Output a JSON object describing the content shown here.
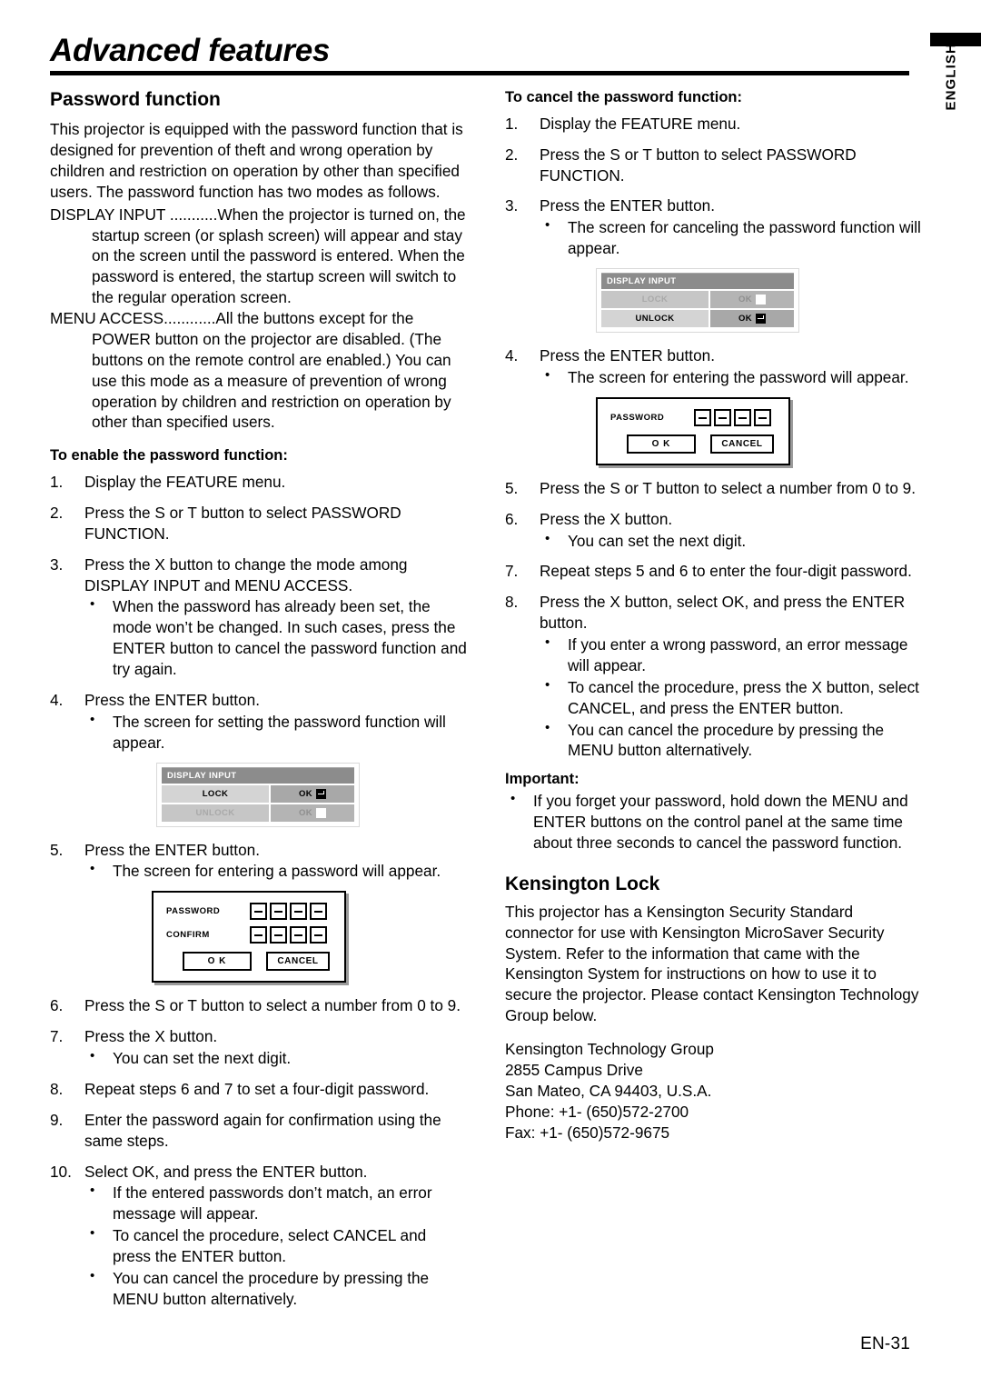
{
  "page": {
    "title": "Advanced features",
    "language_tab": "ENGLISH",
    "folio": "EN-31"
  },
  "left_column": {
    "section_title": "Password function",
    "intro": "This projector is equipped with the password function that is designed for prevention of theft and wrong operation by children and restriction on operation by other than specified users. The password function has two modes as follows.",
    "modes": [
      {
        "name": "DISPLAY INPUT ...........",
        "description": "When the projector is turned on, the startup screen (or splash screen) will appear and stay on the screen until the password is entered. When the password is entered, the startup screen will switch to the regular operation screen."
      },
      {
        "name": "MENU ACCESS............",
        "description": "All the buttons except for the POWER button on the projector are disabled. (The buttons on the remote control are enabled.) You can use this mode as a measure of prevention of wrong operation by children and restriction on operation by other than specified users."
      }
    ],
    "enable_heading": "To enable the password function:",
    "enable_steps": [
      {
        "num": "1.",
        "text": "Display the FEATURE menu."
      },
      {
        "num": "2.",
        "text": "Press the  S or  T button to select PASSWORD FUNCTION."
      },
      {
        "num": "3.",
        "text": "Press the  X button to change the mode among DISPLAY INPUT and MENU ACCESS.",
        "bullets": [
          "When the password has already been set, the mode won’t be changed. In such cases, press the ENTER button to cancel the password function and try again."
        ]
      },
      {
        "num": "4.",
        "text": "Press the ENTER button.",
        "bullets": [
          "The screen for setting the password function will appear."
        ]
      },
      {
        "num": "5.",
        "text": "Press the ENTER button.",
        "bullets": [
          "The screen for entering a password will appear."
        ]
      },
      {
        "num": "6.",
        "text": "Press the  S or  T button to select a number from 0 to 9."
      },
      {
        "num": "7.",
        "text": "Press the  X button.",
        "bullets": [
          "You can set the next digit."
        ]
      },
      {
        "num": "8.",
        "text": "Repeat steps 6 and 7 to set a four-digit password."
      },
      {
        "num": "9.",
        "text": "Enter the password again for confirmation using the same steps."
      },
      {
        "num": "10.",
        "text": "Select OK, and press the ENTER button.",
        "bullets": [
          "If the entered passwords don’t match, an error message will appear.",
          "To cancel the procedure, select CANCEL and press the ENTER button.",
          "You can cancel the procedure by pressing the MENU button alternatively."
        ]
      }
    ],
    "osd_figure": {
      "header": "DISPLAY INPUT",
      "rows": [
        {
          "name": "LOCK",
          "value": "OK",
          "glyph": "enter-key-icon",
          "disabled": false
        },
        {
          "name": "UNLOCK",
          "value": "OK",
          "glyph": "blank-square-icon",
          "disabled": true
        }
      ]
    },
    "password_figure": {
      "rows": [
        {
          "label": "PASSWORD",
          "digits": [
            "-",
            "-",
            "-",
            "-"
          ]
        },
        {
          "label": "CONFIRM",
          "digits": [
            "-",
            "-",
            "-",
            "-"
          ]
        }
      ],
      "ok_label": "O K",
      "cancel_label": "CANCEL"
    }
  },
  "right_column": {
    "cancel_heading": "To cancel the password function:",
    "cancel_steps": [
      {
        "num": "1.",
        "text": "Display the FEATURE menu."
      },
      {
        "num": "2.",
        "text": "Press the  S or  T button to select PASSWORD FUNCTION."
      },
      {
        "num": "3.",
        "text": "Press the ENTER button.",
        "bullets": [
          "The screen for canceling the password function will appear."
        ]
      },
      {
        "num": "4.",
        "text": "Press the ENTER button.",
        "bullets": [
          "The screen for entering the password will appear."
        ]
      },
      {
        "num": "5.",
        "text": "Press the  S or  T button to select a number from 0 to 9."
      },
      {
        "num": "6.",
        "text": "Press the  X button.",
        "bullets": [
          "You can set the next digit."
        ]
      },
      {
        "num": "7.",
        "text": "Repeat steps 5 and 6 to enter the four-digit password."
      },
      {
        "num": "8.",
        "text": "Press the  X button, select OK, and press the ENTER button.",
        "bullets": [
          "If you enter a wrong password, an error message will appear.",
          "To cancel the procedure, press the  X button, select CANCEL, and press the ENTER button.",
          "You can cancel the procedure by pressing the MENU button alternatively."
        ]
      }
    ],
    "osd_figure": {
      "header": "DISPLAY INPUT",
      "rows": [
        {
          "name": "LOCK",
          "value": "OK",
          "glyph": "blank-square-icon",
          "disabled": true
        },
        {
          "name": "UNLOCK",
          "value": "OK",
          "glyph": "enter-key-icon",
          "disabled": false
        }
      ]
    },
    "password_figure": {
      "rows": [
        {
          "label": "PASSWORD",
          "digits": [
            "-",
            "-",
            "-",
            "-"
          ]
        }
      ],
      "ok_label": "O K",
      "cancel_label": "CANCEL"
    },
    "important_heading": "Important:",
    "important_bullets": [
      "If you forget your password, hold down the MENU and ENTER buttons on the control panel at the same time about three seconds to cancel the password function."
    ],
    "kensington_title": "Kensington Lock",
    "kensington_body": "This projector has a Kensington Security Standard connector for use with Kensington MicroSaver Security System. Refer to the information that came with the Kensington System for instructions on how to use it to secure the projector. Please contact Kensington Technology Group below.",
    "kensington_address": [
      "Kensington Technology Group",
      "2855 Campus Drive",
      "San Mateo, CA 94403, U.S.A.",
      "Phone: +1- (650)572-2700",
      "Fax: +1- (650)572-9675"
    ]
  },
  "colors": {
    "osd_header_bg": "#8c8c8c",
    "osd_name_bg": "#d4d4d4",
    "osd_value_bg": "#a8a8a8",
    "text": "#000000",
    "page_bg": "#ffffff"
  }
}
